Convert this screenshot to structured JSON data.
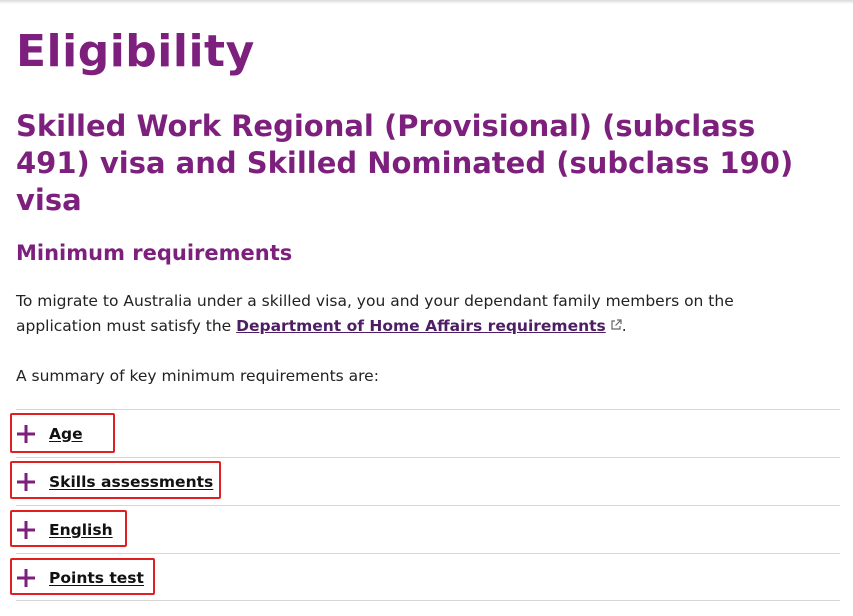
{
  "page": {
    "title": "Eligibility",
    "section_title": "Skilled Work Regional (Provisional) (subclass 491) visa and Skilled Nominated (subclass 190) visa",
    "sub_title": "Minimum requirements",
    "intro_before_link": "To migrate to Australia under a skilled visa, you and your dependant family members on the application must satisfy the ",
    "intro_link": "Department of Home Affairs requirements",
    "intro_after_link": ".",
    "summary": "A summary of key minimum requirements are:"
  },
  "accordion": {
    "items": [
      {
        "label": "Age",
        "icon": "plus-icon"
      },
      {
        "label": "Skills assessments",
        "icon": "plus-icon"
      },
      {
        "label": "English",
        "icon": "plus-icon"
      },
      {
        "label": "Points test",
        "icon": "plus-icon"
      }
    ]
  },
  "colors": {
    "heading": "#7d1f7c",
    "link": "#4d1e63",
    "highlight": "#e02020",
    "divider": "#d6d6d6"
  }
}
